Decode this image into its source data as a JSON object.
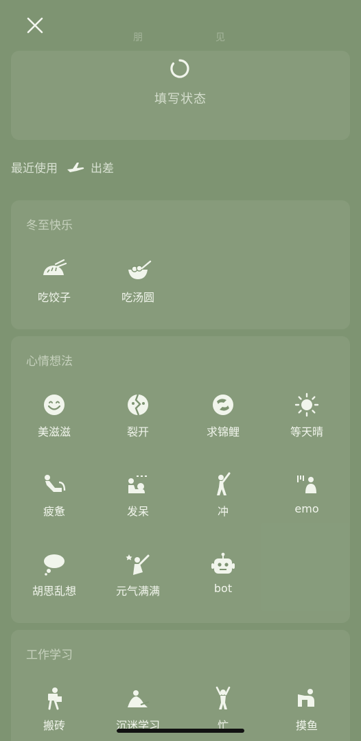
{
  "header": {
    "close_icon": "close-icon",
    "faint_left": "朋",
    "faint_right": "见"
  },
  "status": {
    "label": "填写状态",
    "icon": "spinner-ring-icon"
  },
  "recent": {
    "label": "最近使用",
    "items": [
      {
        "label": "出差",
        "icon": "airplane-icon"
      }
    ]
  },
  "sections": [
    {
      "title": "冬至快乐",
      "items": [
        {
          "label": "吃饺子",
          "icon": "dumpling-icon"
        },
        {
          "label": "吃汤圆",
          "icon": "tangyuan-icon"
        }
      ]
    },
    {
      "title": "心情想法",
      "items": [
        {
          "label": "美滋滋",
          "icon": "smile-icon"
        },
        {
          "label": "裂开",
          "icon": "cracked-face-icon"
        },
        {
          "label": "求锦鲤",
          "icon": "koi-icon"
        },
        {
          "label": "等天晴",
          "icon": "sun-icon"
        },
        {
          "label": "疲惫",
          "icon": "tired-person-icon"
        },
        {
          "label": "发呆",
          "icon": "daze-person-icon"
        },
        {
          "label": "冲",
          "icon": "charge-person-icon"
        },
        {
          "label": "emo",
          "icon": "emo-person-icon"
        },
        {
          "label": "胡思乱想",
          "icon": "thought-bubble-icon"
        },
        {
          "label": "元气满满",
          "icon": "energetic-person-icon"
        },
        {
          "label": "bot",
          "icon": "robot-icon"
        }
      ]
    },
    {
      "title": "工作学习",
      "items": [
        {
          "label": "搬砖",
          "icon": "brick-carry-icon"
        },
        {
          "label": "沉迷学习",
          "icon": "study-person-icon"
        },
        {
          "label": "忙",
          "icon": "busy-person-icon"
        },
        {
          "label": "摸鱼",
          "icon": "slack-off-icon"
        }
      ]
    }
  ]
}
